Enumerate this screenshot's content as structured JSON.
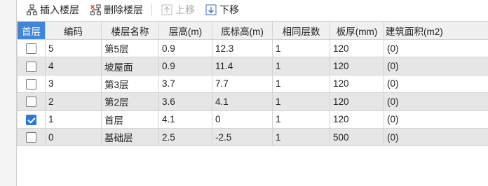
{
  "toolbar": {
    "insert_label": "插入楼层",
    "delete_label": "删除楼层",
    "up_label": "上移",
    "down_label": "下移"
  },
  "table": {
    "headers": {
      "first_floor": "首层",
      "code": "编码",
      "name": "楼层名称",
      "height": "层高(m)",
      "bottom_elev": "底标高(m)",
      "same_count": "相同层数",
      "slab_thickness": "板厚(mm)",
      "area": "建筑面积(m2)"
    },
    "rows": [
      {
        "checked": false,
        "code": "5",
        "name": "第5层",
        "height": "0.9",
        "bottom_elev": "12.3",
        "same_count": "1",
        "slab_thickness": "120",
        "area": "(0)"
      },
      {
        "checked": false,
        "code": "4",
        "name": "坡屋面",
        "height": "0.9",
        "bottom_elev": "11.4",
        "same_count": "1",
        "slab_thickness": "120",
        "area": "(0)"
      },
      {
        "checked": false,
        "code": "3",
        "name": "第3层",
        "height": "3.7",
        "bottom_elev": "7.7",
        "same_count": "1",
        "slab_thickness": "120",
        "area": "(0)"
      },
      {
        "checked": false,
        "code": "2",
        "name": "第2层",
        "height": "3.6",
        "bottom_elev": "4.1",
        "same_count": "1",
        "slab_thickness": "120",
        "area": "(0)"
      },
      {
        "checked": true,
        "code": "1",
        "name": "首层",
        "height": "4.1",
        "bottom_elev": "0",
        "same_count": "1",
        "slab_thickness": "120",
        "area": "(0)"
      },
      {
        "checked": false,
        "code": "0",
        "name": "基础层",
        "height": "2.5",
        "bottom_elev": "-2.5",
        "same_count": "1",
        "slab_thickness": "500",
        "area": "(0)"
      }
    ]
  },
  "icons": {
    "insert": "insert-floor-icon",
    "delete": "delete-floor-icon",
    "up": "move-up-icon",
    "down": "move-down-icon"
  },
  "colors": {
    "accent": "#3f86d9",
    "checked": "#2b78d6",
    "alt_row": "#e6e6e6",
    "header_bg": "#f0f0f0",
    "disabled_text": "#a8a8a8"
  }
}
